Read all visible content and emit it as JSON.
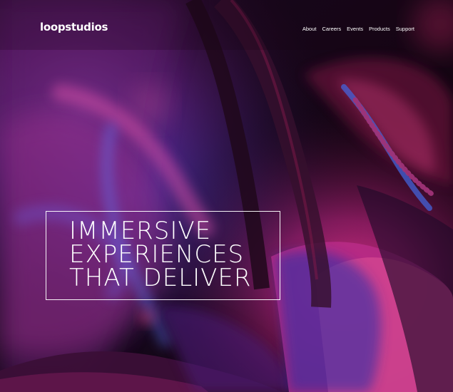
{
  "brand": {
    "name": "loopstudios"
  },
  "navigation": {
    "items": [
      {
        "label": "About"
      },
      {
        "label": "Careers"
      },
      {
        "label": "Events"
      },
      {
        "label": "Products"
      },
      {
        "label": "Support"
      }
    ]
  },
  "hero": {
    "headline_lines": [
      "IMMERSIVE",
      "EXPERIENCES",
      "THAT DELIVER"
    ]
  },
  "colors": {
    "text": "#ffffff",
    "accent_magenta": "#d1348f",
    "accent_blue": "#3b55d6",
    "background_dark": "#120712"
  }
}
